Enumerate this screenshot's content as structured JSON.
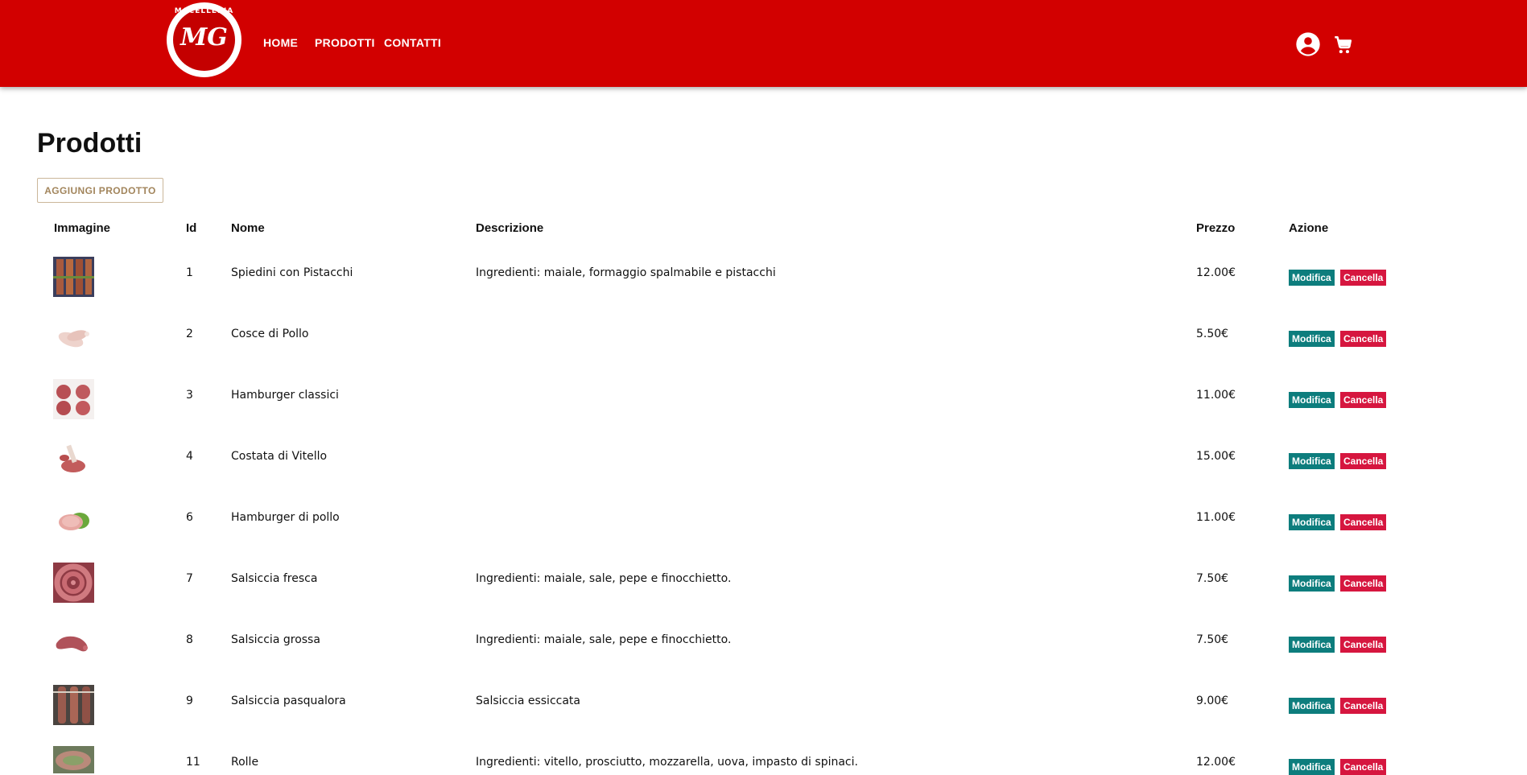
{
  "brand": {
    "logo_text": "MACELLERIA",
    "logo_initials": "MG"
  },
  "nav": {
    "home": "HOME",
    "products": "PRODOTTI",
    "contacts": "CONTATTI"
  },
  "header_icons": {
    "account": "account-circle-icon",
    "cart": "shopping-cart-icon"
  },
  "page": {
    "title": "Prodotti",
    "add_button": "AGGIUNGI PRODOTTO"
  },
  "table": {
    "headers": {
      "image": "Immagine",
      "id": "Id",
      "name": "Nome",
      "description": "Descrizione",
      "price": "Prezzo",
      "action": "Azione"
    },
    "edit_label": "Modifica",
    "delete_label": "Cancella",
    "rows": [
      {
        "id": "1",
        "name": "Spiedini con Pistacchi",
        "description": "Ingredienti: maiale, formaggio spalmabile e pistacchi",
        "price": "12.00€",
        "image": "skewers"
      },
      {
        "id": "2",
        "name": "Cosce di Pollo",
        "description": "",
        "price": "5.50€",
        "image": "chicken-legs"
      },
      {
        "id": "3",
        "name": "Hamburger classici",
        "description": "",
        "price": "11.00€",
        "image": "burgers"
      },
      {
        "id": "4",
        "name": "Costata di Vitello",
        "description": "",
        "price": "15.00€",
        "image": "veal-chop"
      },
      {
        "id": "6",
        "name": "Hamburger di pollo",
        "description": "",
        "price": "11.00€",
        "image": "chicken-burger"
      },
      {
        "id": "7",
        "name": "Salsiccia fresca",
        "description": "Ingredienti: maiale, sale, pepe e finocchietto.",
        "price": "7.50€",
        "image": "fresh-sausage"
      },
      {
        "id": "8",
        "name": "Salsiccia grossa",
        "description": "Ingredienti: maiale, sale, pepe e finocchietto.",
        "price": "7.50€",
        "image": "big-sausage"
      },
      {
        "id": "9",
        "name": "Salsiccia pasqualora",
        "description": "Salsiccia essiccata",
        "price": "9.00€",
        "image": "dried-sausage"
      },
      {
        "id": "11",
        "name": "Rolle",
        "description": "Ingredienti: vitello, prosciutto, mozzarella, uova, impasto di spinaci.",
        "price": "12.00€",
        "image": "rolle"
      }
    ]
  },
  "colors": {
    "header": "#d20000",
    "edit": "#0d7d7d",
    "delete": "#d6163f",
    "add_button_text": "#a2855c"
  }
}
